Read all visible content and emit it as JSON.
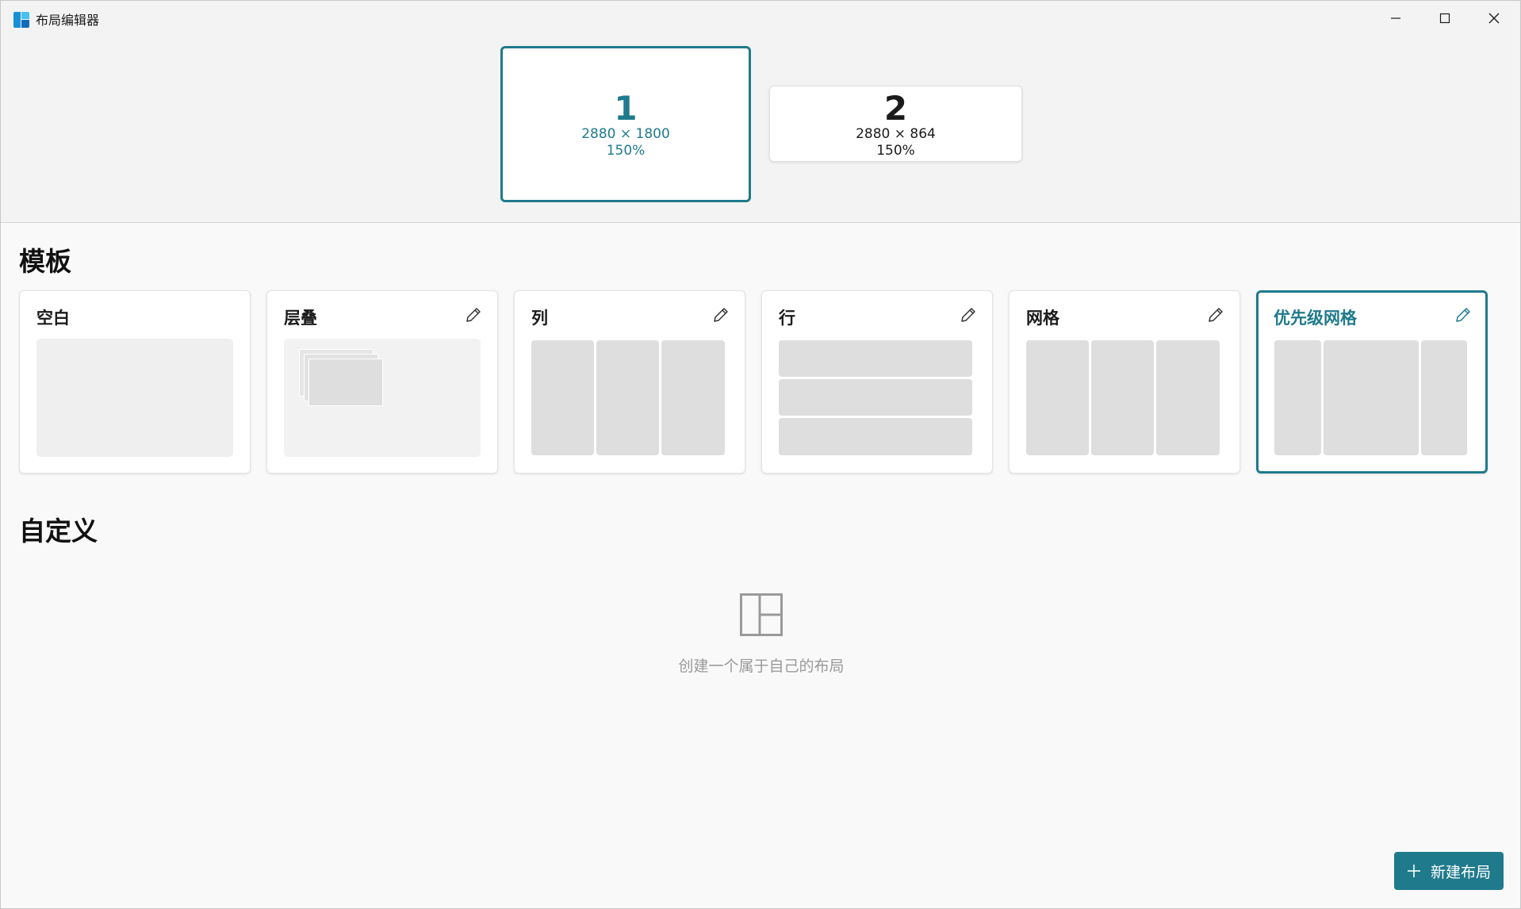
{
  "window": {
    "title": "布局编辑器",
    "controls": [
      "minimize-icon",
      "maximize-icon",
      "close-icon"
    ]
  },
  "monitors": [
    {
      "number": "1",
      "resolution": "2880 × 1800",
      "scale": "150%",
      "selected": true
    },
    {
      "number": "2",
      "resolution": "2880 × 864",
      "scale": "150%",
      "selected": false
    }
  ],
  "templates": {
    "heading": "模板",
    "items": [
      {
        "label": "空白",
        "editable": false,
        "selected": false
      },
      {
        "label": "层叠",
        "editable": true,
        "selected": false
      },
      {
        "label": "列",
        "editable": true,
        "selected": false
      },
      {
        "label": "行",
        "editable": true,
        "selected": false
      },
      {
        "label": "网格",
        "editable": true,
        "selected": false
      },
      {
        "label": "优先级网格",
        "editable": true,
        "selected": true
      }
    ]
  },
  "custom": {
    "heading": "自定义",
    "empty_text": "创建一个属于自己的布局"
  },
  "new_layout_button": {
    "label": "新建布局",
    "icon": "plus-icon"
  },
  "colors": {
    "accent": "#1f7a8c",
    "zone": "#dedede",
    "background": "#f9f9f9"
  }
}
